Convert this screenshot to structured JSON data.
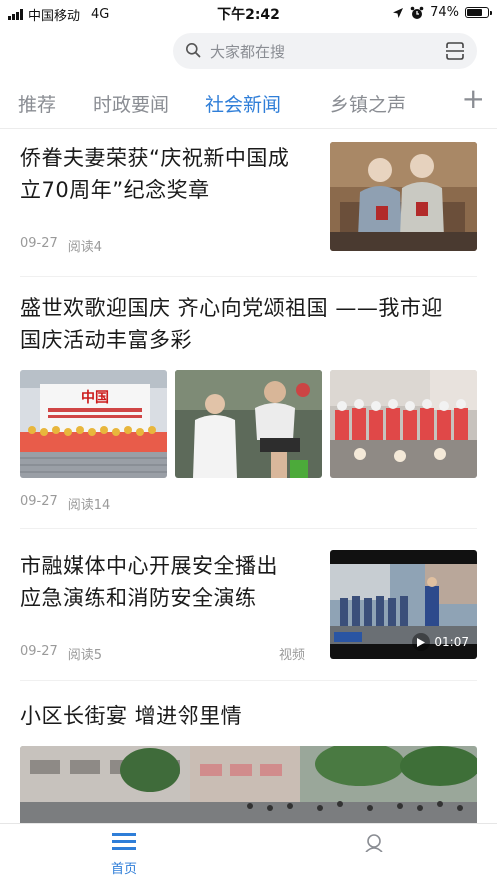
{
  "status_bar": {
    "carrier": "中国移动",
    "network": "4G",
    "time": "下午2:42",
    "battery": "74%",
    "battery_level": 0.74
  },
  "search": {
    "placeholder": "大家都在搜"
  },
  "tabs": [
    {
      "label": "推荐",
      "active": false
    },
    {
      "label": "时政要闻",
      "active": false
    },
    {
      "label": "社会新闻",
      "active": true
    },
    {
      "label": "乡镇之声",
      "active": false
    }
  ],
  "tabs_add_label": "+",
  "news": [
    {
      "title_line1": "侨眷夫妻荣获“庆祝新中国成",
      "title_line2": "立70周年”纪念奖章",
      "date": "09-27",
      "reads": "阅读4"
    },
    {
      "title_line1": "盛世欢歌迎国庆 齐心向党颂祖国 ——我市迎",
      "title_line2": "国庆活动丰富多彩",
      "date": "09-27",
      "reads": "阅读14",
      "image1_banner_text": "中国"
    },
    {
      "title_line1": "市融媒体中心开展安全播出",
      "title_line2": "应急演练和消防安全演练",
      "date": "09-27",
      "reads": "阅读5",
      "badge": "视频",
      "duration": "01:07"
    },
    {
      "title_line1": "小区长街宴 增进邻里情"
    }
  ],
  "bottom_nav": [
    {
      "label": "首页",
      "active": true
    },
    {
      "label": "",
      "active": false
    }
  ],
  "colors": {
    "accent": "#2f7ed8",
    "muted": "#8a8d93"
  }
}
